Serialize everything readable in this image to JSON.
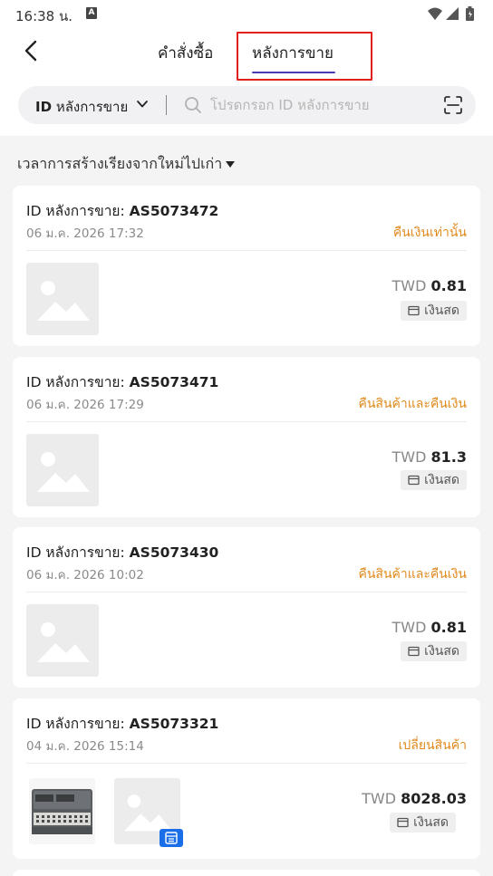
{
  "status_bar": {
    "time": "16:38 น.",
    "notification_icon": "A"
  },
  "header": {
    "tab_orders": "คำสั่งซื้อ",
    "tab_after_sales": "หลังการขาย"
  },
  "search": {
    "type_label_id": "ID",
    "type_label_rest": " หลังการขาย",
    "placeholder": "โปรดกรอก ID หลังการขาย"
  },
  "sort": {
    "label": "เวลาการสร้างเรียงจากใหม่ไปเก่า"
  },
  "cards": [
    {
      "title_prefix": "ID หลังการขาย: ",
      "id": "AS5073472",
      "date": "06 ม.ค. 2026 17:32",
      "status": "คืนเงินเท่านั้น",
      "currency": "TWD ",
      "amount": "0.81",
      "payment": "เงินสด"
    },
    {
      "title_prefix": "ID หลังการขาย: ",
      "id": "AS5073471",
      "date": "06 ม.ค. 2026 17:29",
      "status": "คืนสินค้าและคืนเงิน",
      "currency": "TWD ",
      "amount": "81.3",
      "payment": "เงินสด"
    },
    {
      "title_prefix": "ID หลังการขาย: ",
      "id": "AS5073430",
      "date": "06 ม.ค. 2026 10:02",
      "status": "คืนสินค้าและคืนเงิน",
      "currency": "TWD ",
      "amount": "0.81",
      "payment": "เงินสด"
    },
    {
      "title_prefix": "ID หลังการขาย: ",
      "id": "AS5073321",
      "date": "04 ม.ค. 2026 15:14",
      "status": "เปลี่ยนสินค้า",
      "currency": "TWD ",
      "amount": "8028.03",
      "payment": "เงินสด"
    }
  ],
  "colors": {
    "accent_tab": "#4b3bb5",
    "highlight_border": "#e0201a",
    "status_orange": "#e08a1e",
    "badge_blue": "#1a6fe8"
  },
  "icons": [
    "back-arrow-icon",
    "chevron-down-icon",
    "search-icon",
    "scan-icon",
    "caret-down-icon",
    "image-placeholder-icon",
    "wallet-icon",
    "bundle-icon",
    "wifi-icon",
    "signal-icon",
    "battery-icon"
  ]
}
